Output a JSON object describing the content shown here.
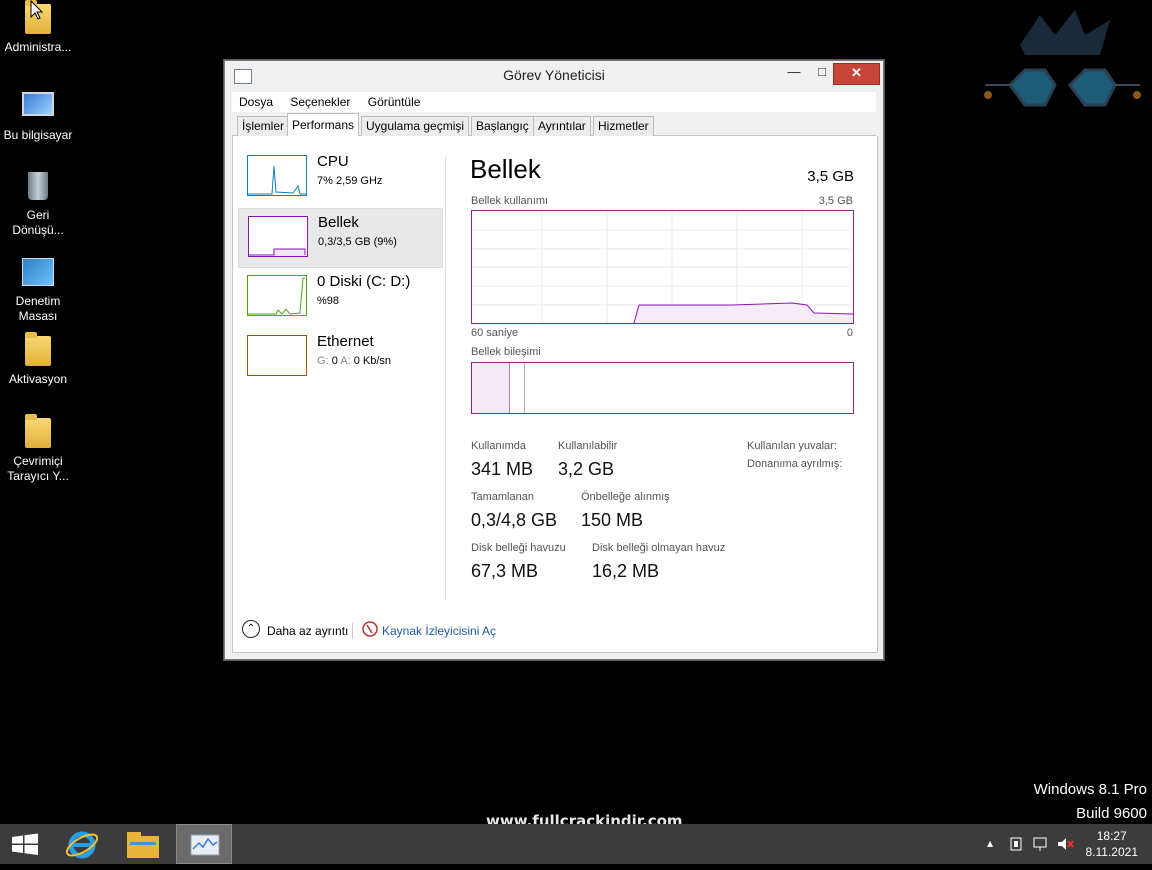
{
  "desktop": {
    "icons": [
      {
        "label": "Administra..."
      },
      {
        "label": "Bu bilgisayar"
      },
      {
        "label": "Geri Dönüşü..."
      },
      {
        "label": "Denetim Masası"
      },
      {
        "label": "Aktivasyon"
      },
      {
        "label": "Çevrimiçi Tarayıcı Y..."
      }
    ],
    "os_name": "Windows 8.1 Pro",
    "os_build": "Build 9600",
    "site": "www.fullcrackindir.com"
  },
  "window": {
    "title": "Görev Yöneticisi",
    "menu": [
      "Dosya",
      "Seçenekler",
      "Görüntüle"
    ],
    "tabs": [
      "İşlemler",
      "Performans",
      "Uygulama geçmişi",
      "Başlangıç",
      "Ayrıntılar",
      "Hizmetler"
    ],
    "active_tab": "Performans",
    "left_items": [
      {
        "name": "CPU",
        "sub": "7%  2,59 GHz",
        "color": "#117dbb"
      },
      {
        "name": "Bellek",
        "sub": "0,3/3,5 GB (9%)",
        "color": "#8b12ae"
      },
      {
        "name": "0 Diski (C: D:)",
        "sub": "%98",
        "color": "#4da60c"
      },
      {
        "name": "Ethernet",
        "sub_label_g": "G:",
        "sub_value_g": "0",
        "sub_label_a": "A:",
        "sub_value_a": "0 Kb/sn",
        "color": "#a74f01"
      }
    ],
    "detail": {
      "title": "Bellek",
      "total": "3,5 GB",
      "usage_label": "Bellek kullanımı",
      "usage_max": "3,5 GB",
      "axis_left": "60 saniye",
      "axis_right": "0",
      "composition_label": "Bellek bileşimi",
      "stats": {
        "in_use_label": "Kullanımda",
        "in_use": "341 MB",
        "available_label": "Kullanılabilir",
        "available": "3,2 GB",
        "committed_label": "Tamamlanan",
        "committed": "0,3/4,8 GB",
        "cached_label": "Önbelleğe alınmış",
        "cached": "150 MB",
        "paged_label": "Disk belleği havuzu",
        "paged": "67,3 MB",
        "nonpaged_label": "Disk belleği olmayan havuz",
        "nonpaged": "16,2 MB",
        "slots_label": "Kullanılan yuvalar:",
        "reserved_label": "Donanıma ayrılmış:"
      }
    },
    "footer": {
      "fewer_details": "Daha az ayrıntı",
      "resource_monitor": "Kaynak İzleyicisini Aç"
    }
  },
  "taskbar": {
    "time": "18:27",
    "date": "8.11.2021"
  }
}
